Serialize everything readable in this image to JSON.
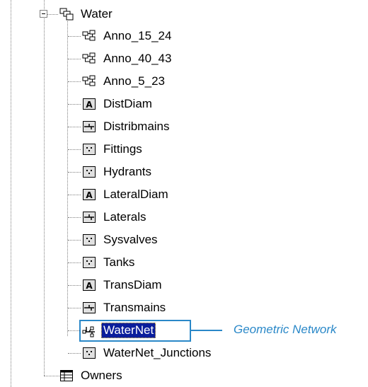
{
  "tree": {
    "group": {
      "label": "Water",
      "icon": "feature-dataset-icon",
      "expanded": true
    },
    "children": [
      {
        "label": "Anno_15_24",
        "icon": "annotation-class-icon"
      },
      {
        "label": "Anno_40_43",
        "icon": "annotation-class-icon"
      },
      {
        "label": "Anno_5_23",
        "icon": "annotation-class-icon"
      },
      {
        "label": "DistDiam",
        "icon": "text-feature-class-icon"
      },
      {
        "label": "Distribmains",
        "icon": "line-feature-class-icon"
      },
      {
        "label": "Fittings",
        "icon": "point-feature-class-icon"
      },
      {
        "label": "Hydrants",
        "icon": "point-feature-class-icon"
      },
      {
        "label": "LateralDiam",
        "icon": "text-feature-class-icon"
      },
      {
        "label": "Laterals",
        "icon": "line-feature-class-icon"
      },
      {
        "label": "Sysvalves",
        "icon": "point-feature-class-icon"
      },
      {
        "label": "Tanks",
        "icon": "point-feature-class-icon"
      },
      {
        "label": "TransDiam",
        "icon": "text-feature-class-icon"
      },
      {
        "label": "Transmains",
        "icon": "line-feature-class-icon"
      },
      {
        "label": "WaterNet",
        "icon": "geometric-network-icon",
        "selected": true
      },
      {
        "label": "WaterNet_Junctions",
        "icon": "point-feature-class-icon"
      }
    ],
    "sibling": {
      "label": "Owners",
      "icon": "table-icon"
    }
  },
  "callout": {
    "text": "Geometric Network",
    "color": "#2a88c8"
  }
}
